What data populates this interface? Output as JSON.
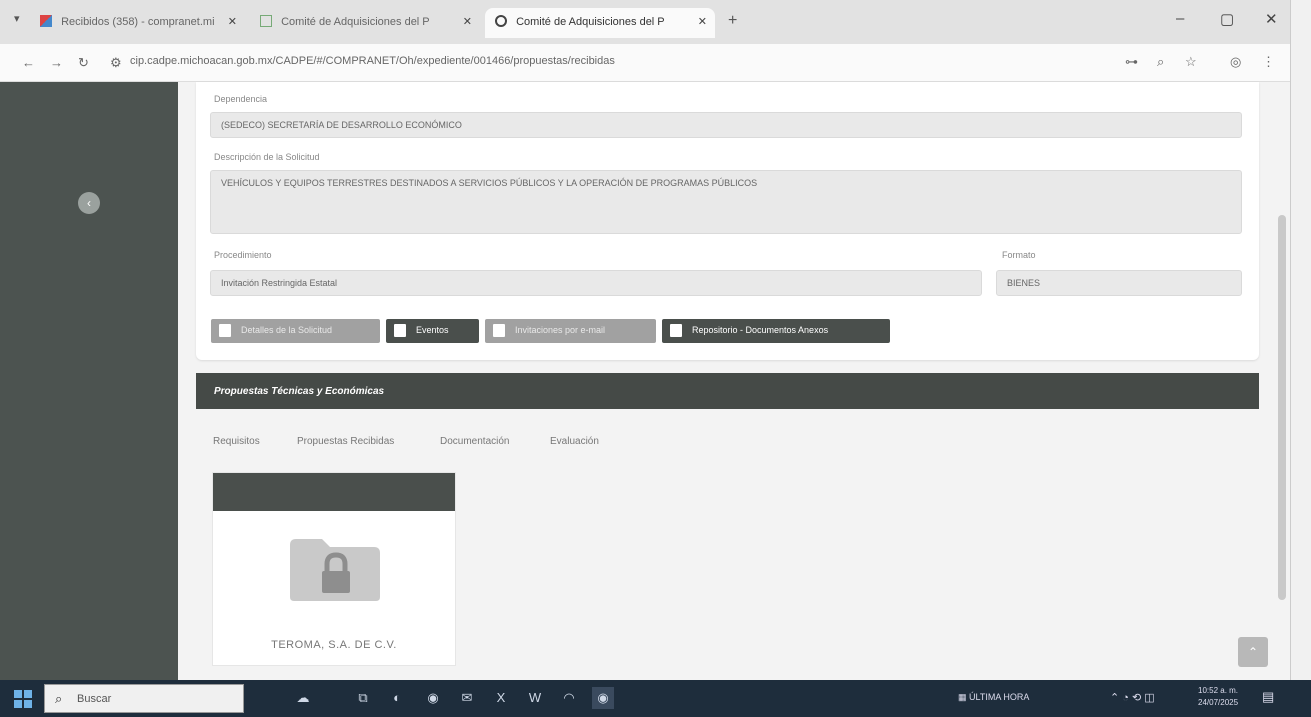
{
  "browser": {
    "tabs": [
      {
        "label": "Recibidos (358) - compranet.mi",
        "active": false
      },
      {
        "label": "Comité de Adquisiciones del P",
        "active": false
      },
      {
        "label": "Comité de Adquisiciones del P",
        "active": true
      }
    ],
    "url": "cip.cadpe.michoacan.gob.mx/CADPE/#/COMPRANET/Oh/expediente/001466/propuestas/recibidas",
    "icons": {
      "menu": "chevron-down-icon",
      "close": "close-icon",
      "new_tab": "plus-icon",
      "back": "arrow-left-icon",
      "forward": "arrow-right-icon",
      "reload": "reload-icon",
      "site_info": "site-info-icon",
      "zoom": "zoom-icon",
      "star": "star-icon",
      "extensions": "extensions-icon",
      "more": "more-icon"
    }
  },
  "form": {
    "dependencia_label": "Dependencia",
    "dependencia_value": "(SEDECO) SECRETARÍA DE DESARROLLO ECONÓMICO",
    "descripcion_label": "Descripción de la Solicitud",
    "descripcion_value": "VEHÍCULOS Y EQUIPOS TERRESTRES DESTINADOS A SERVICIOS PÚBLICOS Y LA OPERACIÓN DE PROGRAMAS PÚBLICOS",
    "procedimiento_label": "Procedimiento",
    "procedimiento_value": "Invitación Restringida Estatal",
    "formato_label": "Formato",
    "formato_value": "BIENES"
  },
  "actions": [
    {
      "label": "Detalles de la Solicitud",
      "style": "gray",
      "icon": "document-icon"
    },
    {
      "label": "Eventos",
      "style": "dark",
      "icon": "calendar-icon"
    },
    {
      "label": "Invitaciones por e-mail",
      "style": "gray",
      "icon": "email-icon"
    },
    {
      "label": "Repositorio - Documentos Anexos",
      "style": "dark",
      "icon": "archive-icon"
    }
  ],
  "section": {
    "title": "Propuestas Técnicas y Económicas",
    "tabs": [
      "Requisitos",
      "Propuestas Recibidas",
      "Documentación",
      "Evaluación"
    ],
    "proposal_name": "TEROMA, S.A. DE C.V."
  },
  "taskbar": {
    "search_placeholder": "Buscar",
    "news": "ÚLTIMA HORA",
    "time": "10:52 a. m.",
    "date": "24/07/2025"
  },
  "colors": {
    "sidebar": "#4c5350",
    "section_bar": "#454a47",
    "field_bg": "#e9e9e9",
    "taskbar": "#1e2d3c"
  }
}
